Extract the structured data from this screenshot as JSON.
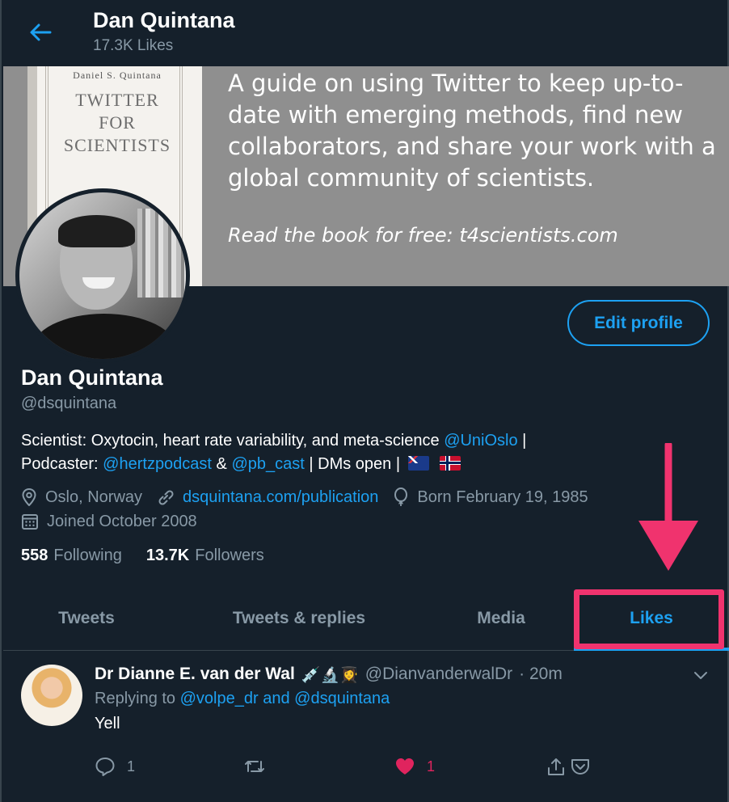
{
  "header": {
    "title": "Dan Quintana",
    "subtitle": "17.3K Likes"
  },
  "banner": {
    "book_author": "Daniel S. Quintana",
    "book_title_line1": "TWITTER",
    "book_title_line2": "FOR",
    "book_title_line3": "SCIENTISTS",
    "text": "A guide on using Twitter to keep up-to-date with emerging methods, find new collaborators, and share your work with a global community of scientists.",
    "link_text": "Read the book for free: t4scientists.com"
  },
  "profile": {
    "edit_label": "Edit profile",
    "name": "Dan Quintana",
    "handle": "@dsquintana",
    "bio": {
      "part1": "Scientist: Oxytocin, heart rate variability, and meta-science ",
      "mention1": "@UniOslo",
      "part2": " |",
      "part3": "Podcaster: ",
      "mention2": "@hertzpodcast",
      "part4": " & ",
      "mention3": "@pb_cast",
      "part5": " | DMs open |"
    },
    "location": "Oslo, Norway",
    "website": "dsquintana.com/publication",
    "born": "Born February 19, 1985",
    "joined": "Joined October 2008",
    "following_count": "558",
    "following_label": "Following",
    "followers_count": "13.7K",
    "followers_label": "Followers"
  },
  "tabs": [
    {
      "label": "Tweets"
    },
    {
      "label": "Tweets & replies"
    },
    {
      "label": "Media"
    },
    {
      "label": "Likes",
      "active": true
    }
  ],
  "tweet": {
    "name": "Dr Dianne E. van der Wal",
    "emojis": "💉🔬👩‍🎓",
    "handle": "@DianvanderwalDr",
    "time": "· 20m",
    "reply_prefix": "Replying to ",
    "reply_to1": "@volpe_dr",
    "reply_and": " and ",
    "reply_to2": "@dsquintana",
    "text": "Yell",
    "reply_count": "1",
    "like_count": "1"
  },
  "colors": {
    "background": "#15202b",
    "accent": "#1da1f2",
    "muted": "#8899a6",
    "highlight": "#f0336e",
    "like": "#e0245e"
  }
}
